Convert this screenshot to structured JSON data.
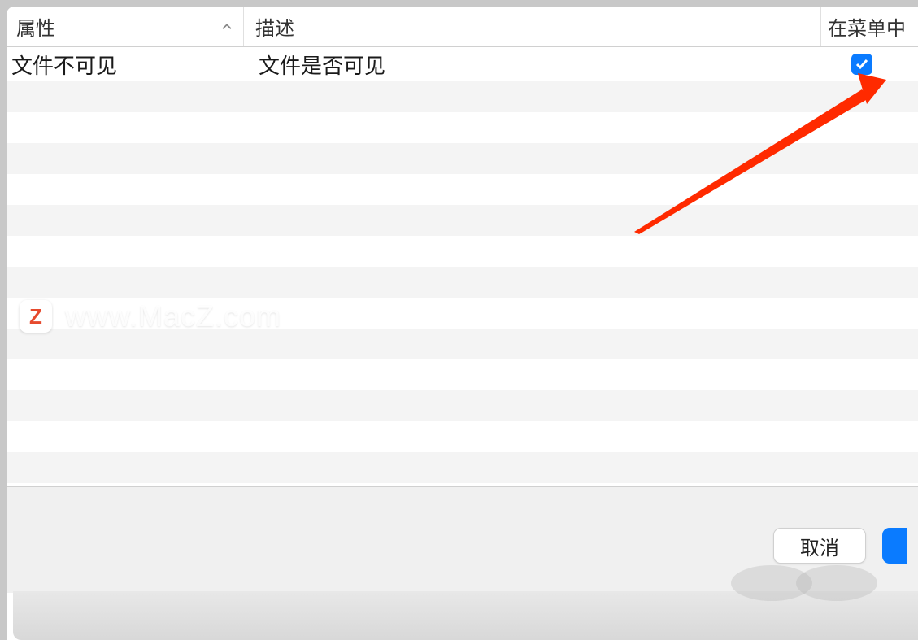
{
  "header": {
    "col_attr": "属性",
    "col_desc": "描述",
    "col_menu": "在菜单中"
  },
  "rows": [
    {
      "attr": "文件不可见",
      "desc": "文件是否可见",
      "checked": true
    }
  ],
  "footer": {
    "cancel_label": "取消"
  },
  "watermark": {
    "logo_letter": "Z",
    "text": "www.MacZ.com"
  }
}
